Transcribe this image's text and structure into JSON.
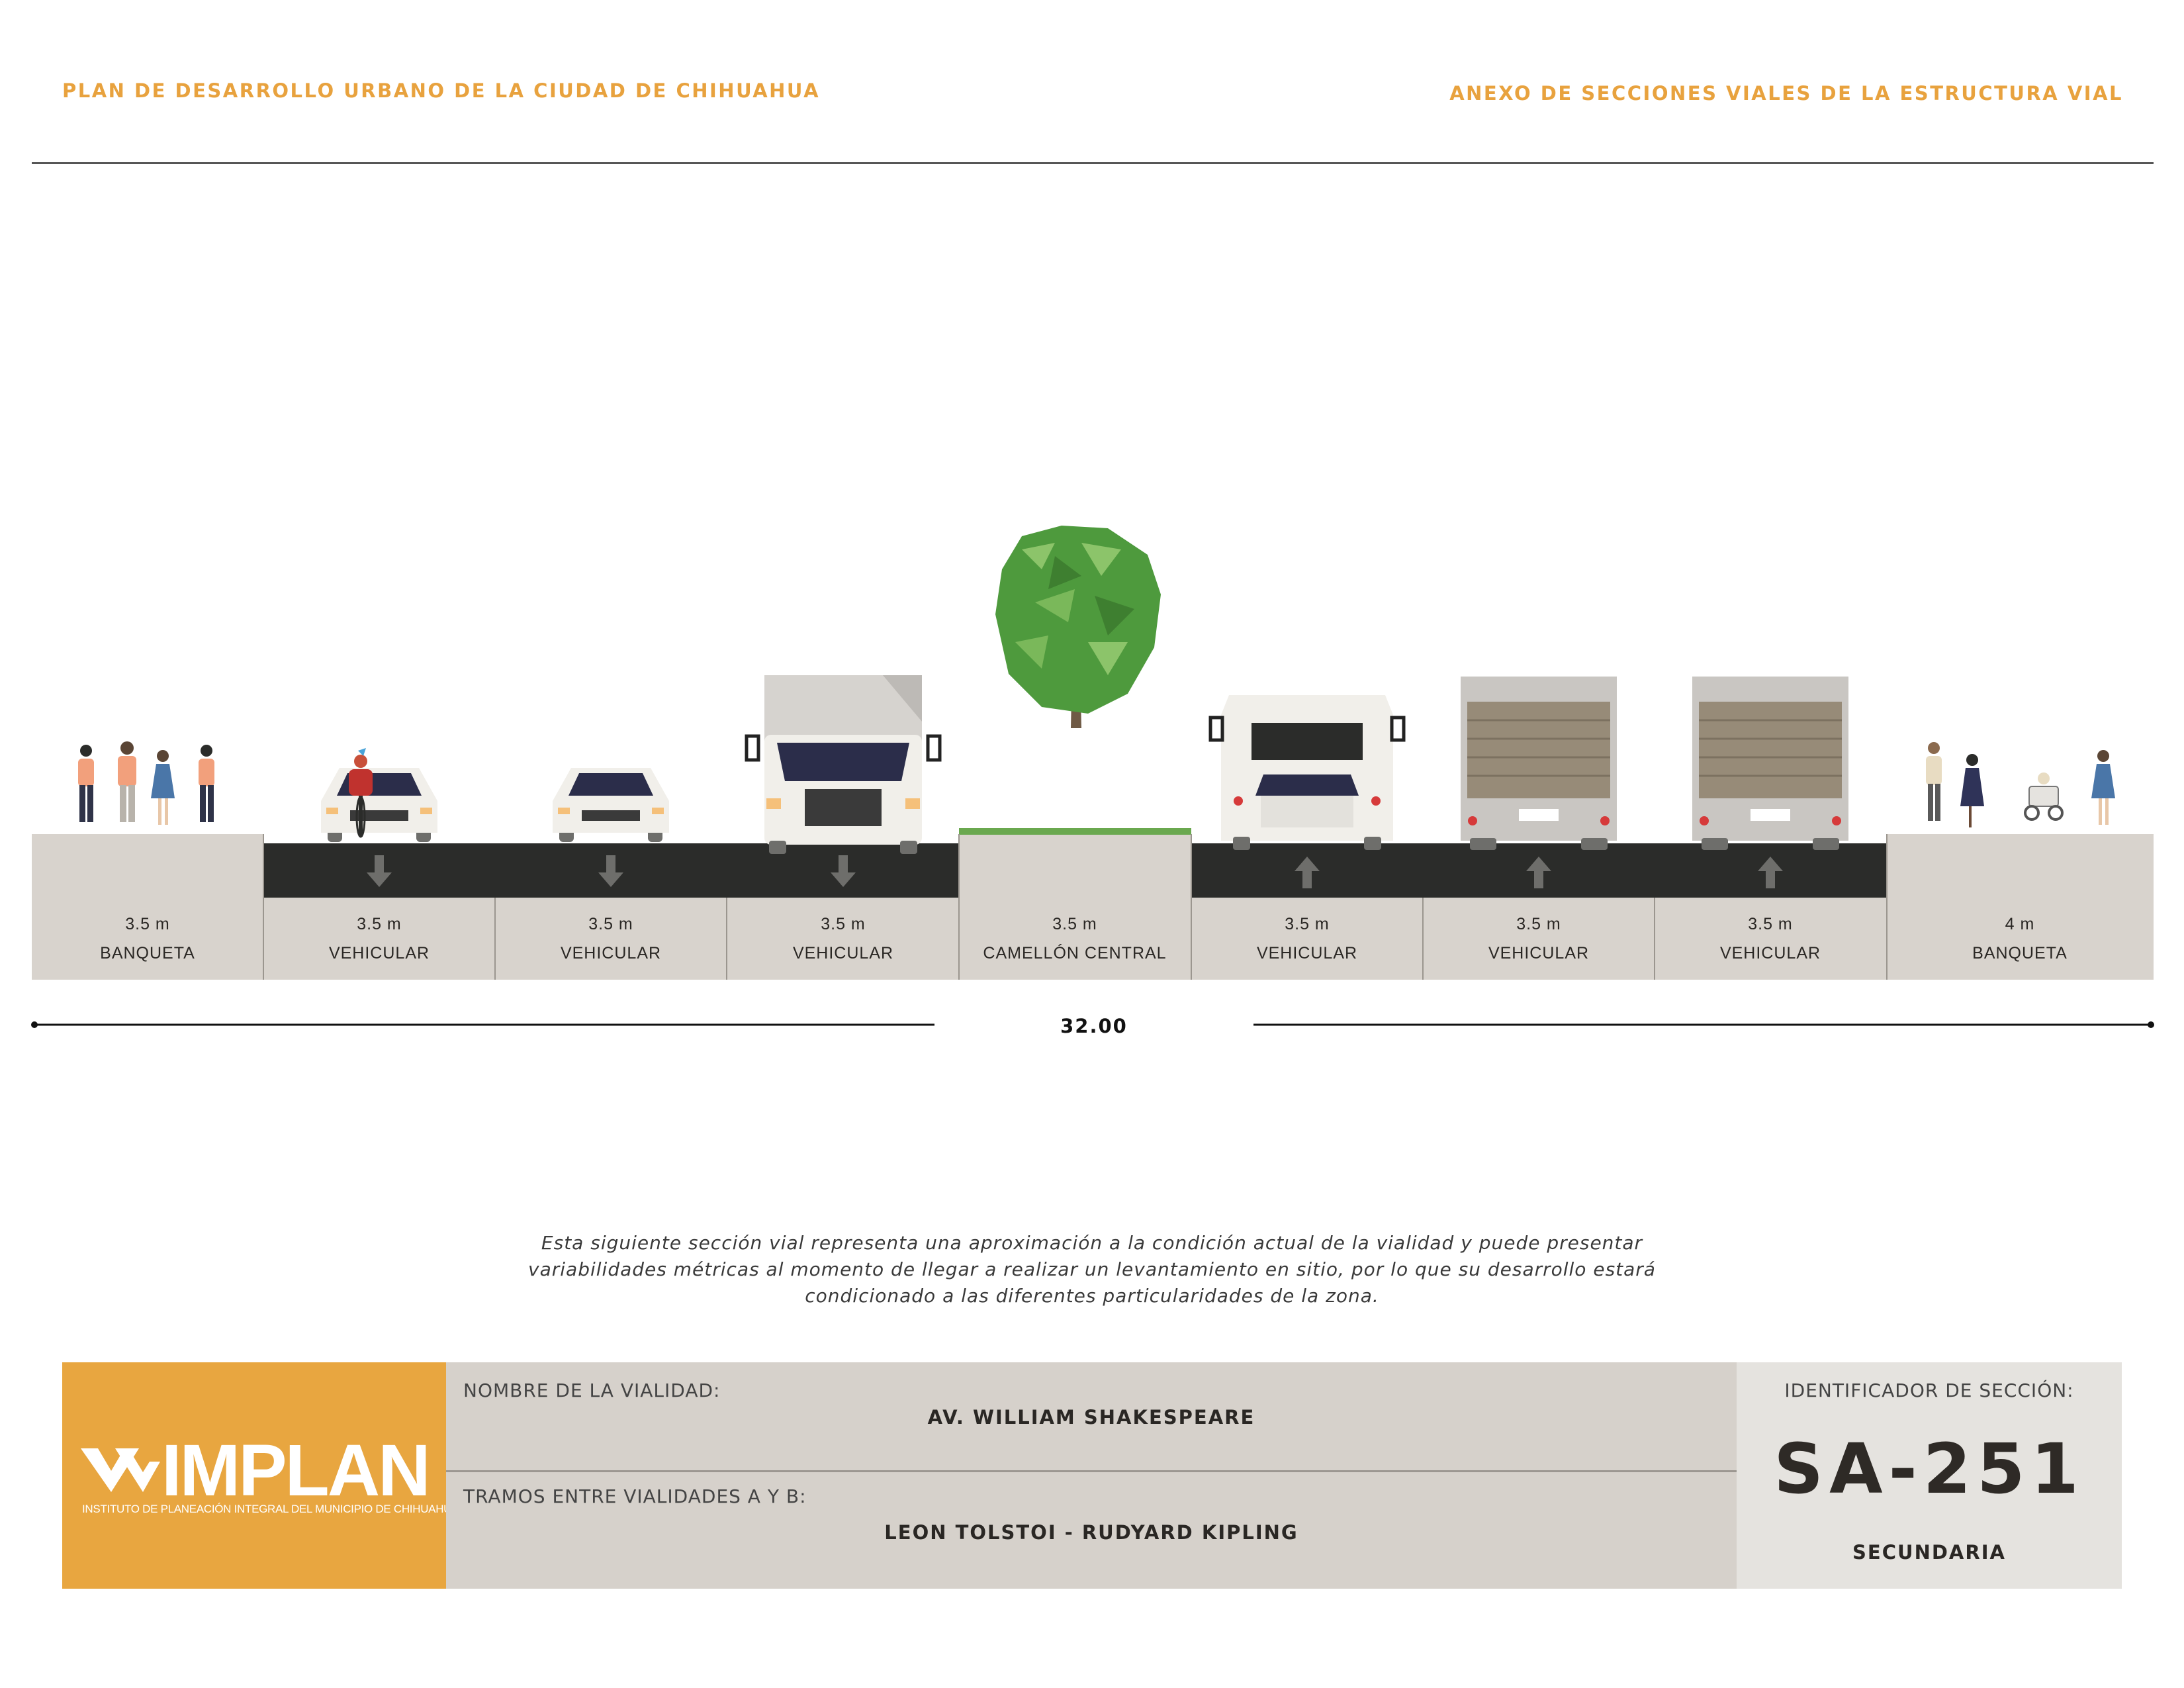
{
  "header": {
    "left_title": "PLAN DE DESARROLLO URBANO DE LA CIUDAD DE CHIHUAHUA",
    "right_title": "ANEXO DE SECCIONES VIALES DE LA ESTRUCTURA VIAL"
  },
  "section": {
    "segments": [
      {
        "width": "3.5 m",
        "name": "BANQUETA",
        "kind": "sidewalk"
      },
      {
        "width": "3.5 m",
        "name": "VEHICULAR",
        "kind": "lane",
        "direction": "down"
      },
      {
        "width": "3.5 m",
        "name": "VEHICULAR",
        "kind": "lane",
        "direction": "down"
      },
      {
        "width": "3.5 m",
        "name": "VEHICULAR",
        "kind": "lane",
        "direction": "down"
      },
      {
        "width": "3.5 m",
        "name": "CAMELLÓN CENTRAL",
        "kind": "median"
      },
      {
        "width": "3.5 m",
        "name": "VEHICULAR",
        "kind": "lane",
        "direction": "up"
      },
      {
        "width": "3.5 m",
        "name": "VEHICULAR",
        "kind": "lane",
        "direction": "up"
      },
      {
        "width": "3.5 m",
        "name": "VEHICULAR",
        "kind": "lane",
        "direction": "up"
      },
      {
        "width": "4 m",
        "name": "BANQUETA",
        "kind": "sidewalk"
      }
    ],
    "total_width": "32.00",
    "colors": {
      "asphalt": "#2b2c2a",
      "sidewalk": "#d8d3cd",
      "divider": "#9b968f",
      "tree": "#4e9a3d",
      "trunk": "#6f5a45"
    }
  },
  "caption": [
    "Esta siguiente sección vial representa una aproximación a la condición actual de la vialidad y puede presentar",
    "variabilidades métricas al momento de llegar a realizar un levantamiento en sitio, por lo que su desarrollo estará",
    "condicionado a las diferentes particularidades de la zona."
  ],
  "info": {
    "logo_word": "IMPLAN",
    "logo_subtitle": "INSTITUTO DE PLANEACIÓN INTEGRAL DEL MUNICIPIO DE CHIHUAHUA",
    "road_name_label": "NOMBRE DE LA VIALIDAD:",
    "road_name": "AV. WILLIAM SHAKESPEARE",
    "segment_label": "TRAMOS ENTRE VIALIDADES A Y B:",
    "segment": "LEON TOLSTOI - RUDYARD KIPLING",
    "id_label": "IDENTIFICADOR DE SECCIÓN:",
    "id_code": "SA-251",
    "classification": "SECUNDARIA",
    "brand_color": "#e8a640"
  }
}
